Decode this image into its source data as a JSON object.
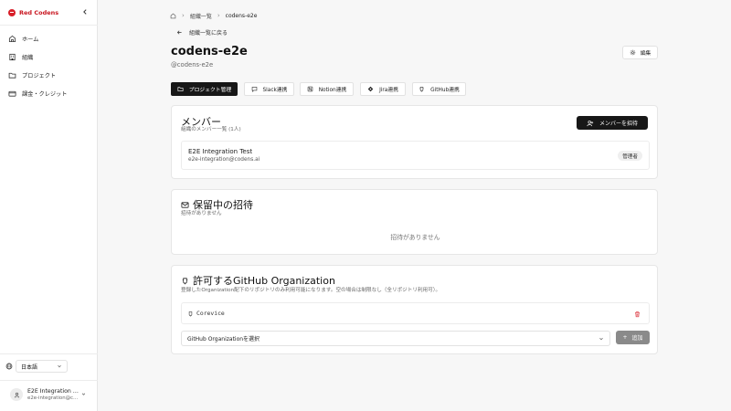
{
  "sidebar": {
    "brand": "Red Codens",
    "items": [
      {
        "label": "ホーム",
        "icon": "home-icon"
      },
      {
        "label": "組織",
        "icon": "building-icon"
      },
      {
        "label": "プロジェクト",
        "icon": "folder-icon"
      },
      {
        "label": "課金・クレジット",
        "icon": "credit-card-icon"
      }
    ],
    "language": "日本語",
    "user": {
      "name": "E2E Integration Test",
      "email": "e2e-integration@codens.ai"
    }
  },
  "breadcrumb": {
    "parent": "組織一覧",
    "current": "codens-e2e"
  },
  "back_label": "組織一覧に戻る",
  "org": {
    "name": "codens-e2e",
    "handle": "@codens-e2e"
  },
  "edit_label": "編集",
  "tabs": [
    {
      "label": "プロジェクト管理",
      "active": true
    },
    {
      "label": "Slack連携",
      "active": false
    },
    {
      "label": "Notion連携",
      "active": false
    },
    {
      "label": "Jira連携",
      "active": false
    },
    {
      "label": "GitHub連携",
      "active": false
    }
  ],
  "members": {
    "title": "メンバー",
    "subtitle": "組織のメンバー一覧 (1人)",
    "invite_label": "メンバーを招待",
    "list": [
      {
        "name": "E2E Integration Test",
        "email": "e2e-integration@codens.ai",
        "role": "管理者"
      }
    ]
  },
  "pending": {
    "title": "保留中の招待",
    "subtitle": "招待がありません",
    "empty": "招待がありません"
  },
  "github_orgs": {
    "title": "許可するGitHub Organization",
    "subtitle": "登録したOrganization配下のリポジトリのみ利用可能になります。空の場合は制限なし（全リポジトリ利用可）。",
    "repos": [
      {
        "name": "Corevice"
      }
    ],
    "select_placeholder": "GitHub Organizationを選択",
    "add_label": "追加"
  },
  "colors": {
    "brand": "#d81e28",
    "primary": "#171717",
    "disabled": "#8a8a8a"
  }
}
